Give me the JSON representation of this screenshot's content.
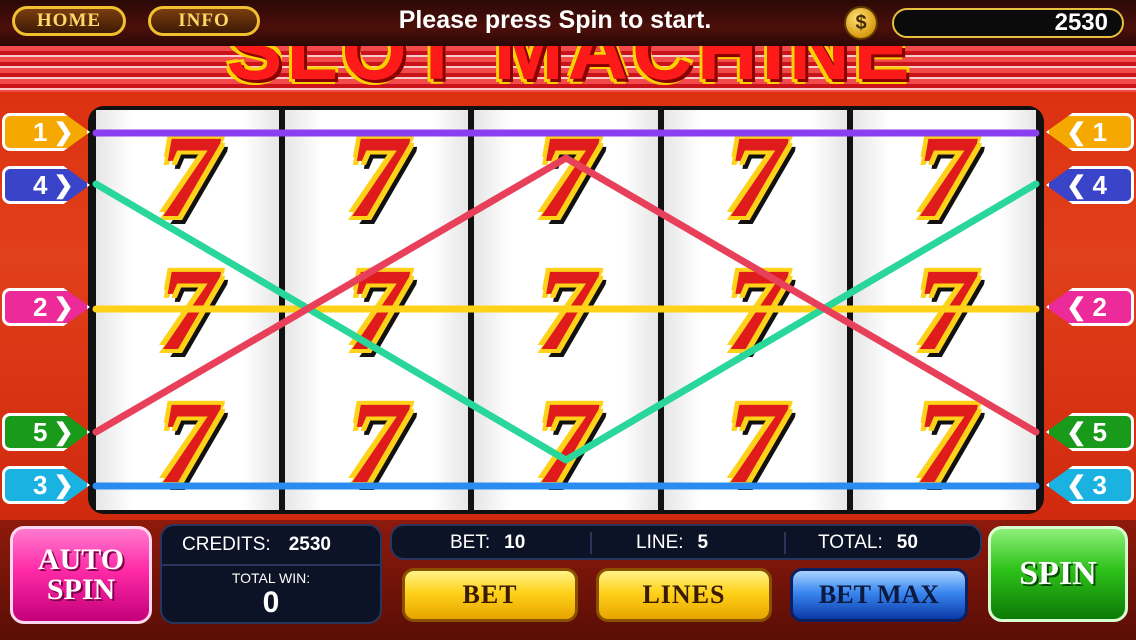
{
  "header": {
    "home_label": "HOME",
    "info_label": "INFO",
    "message": "Please press Spin to start.",
    "balance": "2530",
    "coin_symbol": "$"
  },
  "title": "SLOT MACHINE",
  "reels": {
    "symbol": "7",
    "columns": 5,
    "rows": 3
  },
  "paylines": [
    {
      "number": "1",
      "color": "#8a3ef0"
    },
    {
      "number": "2",
      "color": "#ffd21a"
    },
    {
      "number": "3",
      "color": "#2a8cf0"
    },
    {
      "number": "4",
      "color": "#2ad79a"
    },
    {
      "number": "5",
      "color": "#e8405a"
    }
  ],
  "markers": {
    "m1": "1",
    "m4": "4",
    "m2": "2",
    "m5": "5",
    "m3": "3",
    "colors": {
      "m1": "#f5a800",
      "m4": "#3a44c8",
      "m2": "#ec2a9a",
      "m5": "#1a9a1a",
      "m3": "#1ab2e0"
    }
  },
  "panel": {
    "auto_spin_line1": "AUTO",
    "auto_spin_line2": "SPIN",
    "credits_label": "CREDITS:",
    "credits_value": "2530",
    "total_win_label": "TOTAL WIN:",
    "total_win_value": "0",
    "bet_label": "BET:",
    "bet_value": "10",
    "line_label": "LINE:",
    "line_value": "5",
    "total_label": "TOTAL:",
    "total_value": "50",
    "bet_button": "BET",
    "lines_button": "LINES",
    "bet_max_button": "BET MAX",
    "spin_button": "SPIN"
  }
}
